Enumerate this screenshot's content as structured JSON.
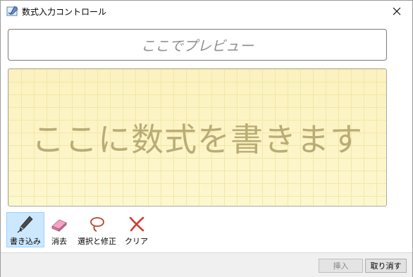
{
  "window": {
    "title": "数式入力コントロール"
  },
  "preview": {
    "placeholder": "ここでプレビュー"
  },
  "canvas": {
    "hint": "ここに数式を書きます"
  },
  "tools": [
    {
      "label": "書き込み",
      "icon": "pen-icon",
      "active": true
    },
    {
      "label": "消去",
      "icon": "eraser-icon",
      "active": false
    },
    {
      "label": "選択と修正",
      "icon": "lasso-icon",
      "active": false
    },
    {
      "label": "クリア",
      "icon": "clear-x-icon",
      "active": false
    }
  ],
  "footer": {
    "insert_label": "挿入",
    "cancel_label": "取り消す"
  },
  "colors": {
    "active_tool_bg": "#cce8ff",
    "canvas_bg": "#fdf6c8",
    "clear_red": "#d43a2f"
  }
}
